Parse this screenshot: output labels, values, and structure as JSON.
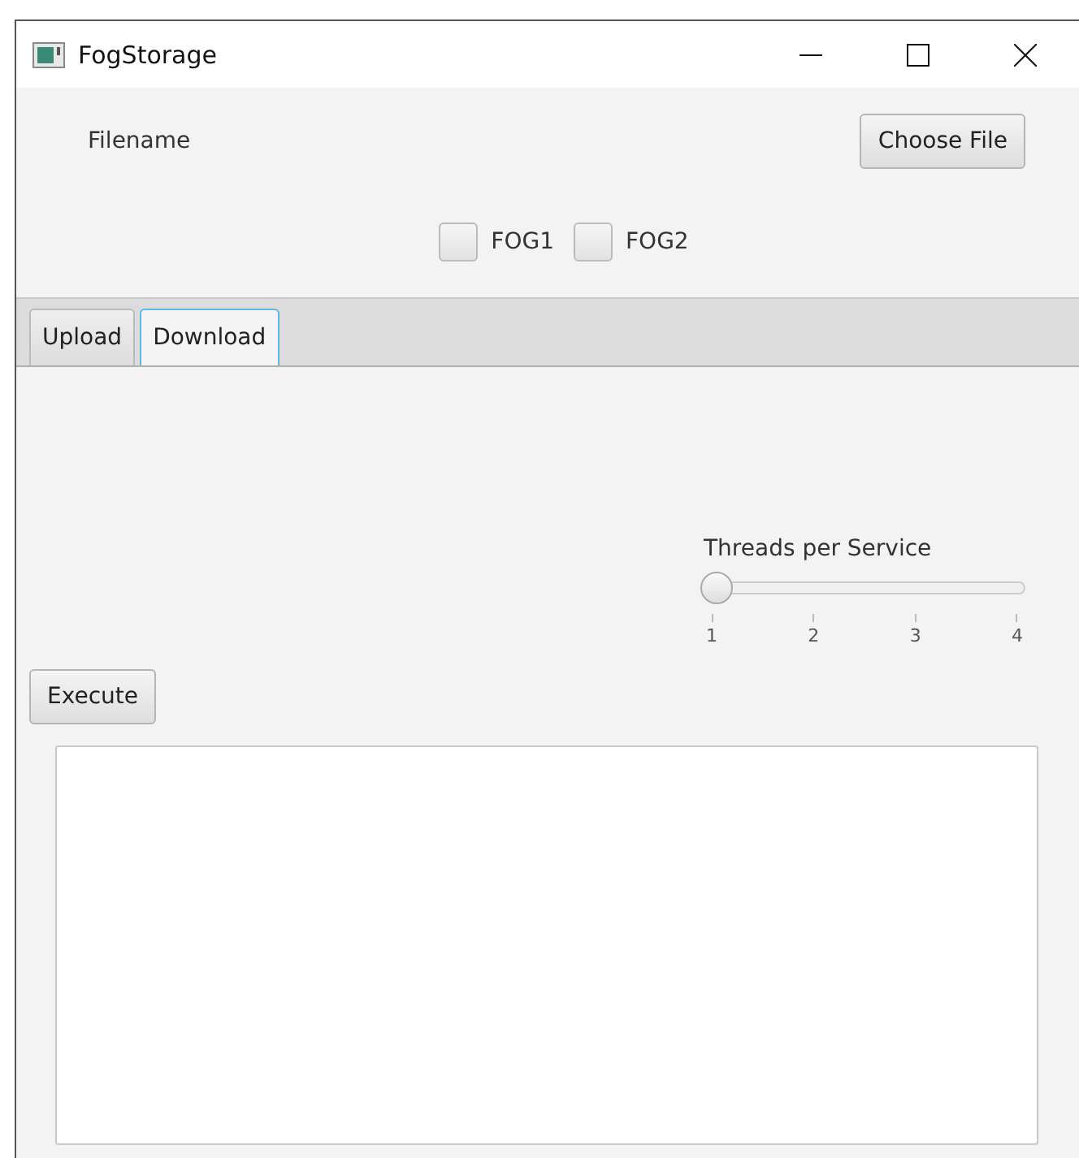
{
  "window": {
    "title": "FogStorage"
  },
  "file": {
    "label": "Filename",
    "button": "Choose File"
  },
  "fogs": [
    {
      "label": "FOG1",
      "checked": false
    },
    {
      "label": "FOG2",
      "checked": false
    }
  ],
  "tabs": [
    {
      "label": "Upload",
      "selected": false
    },
    {
      "label": "Download",
      "selected": true
    }
  ],
  "slider": {
    "label": "Threads per Service",
    "level": 0,
    "ticks": [
      "1",
      "2",
      "3",
      "4"
    ]
  },
  "execute": "Execute"
}
